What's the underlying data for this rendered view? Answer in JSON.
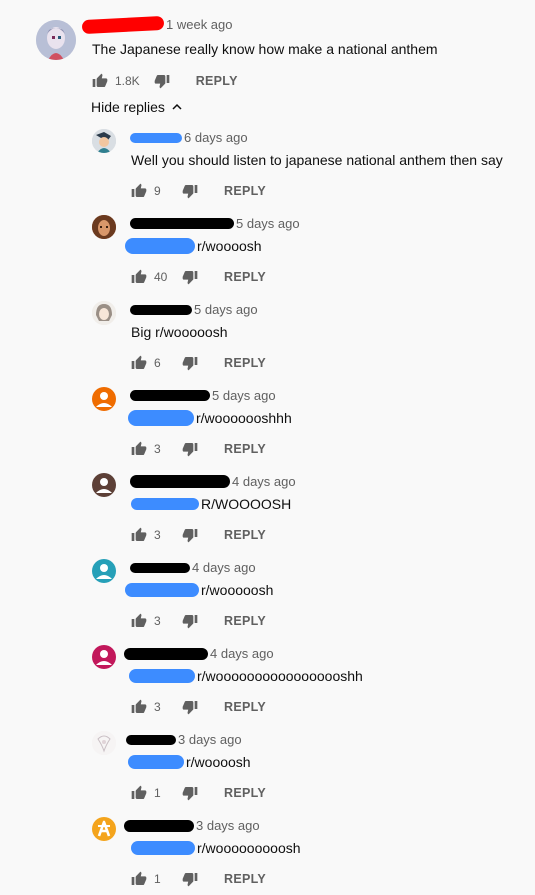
{
  "top_comment": {
    "time": "1 week ago",
    "text": "The Japanese really know how make a national anthem",
    "likes": "1.8K",
    "reply_label": "REPLY"
  },
  "hide_replies_label": "Hide replies",
  "replies": [
    {
      "time": "6 days ago",
      "text": "Well you should listen to japanese national anthem then say",
      "likes": "9",
      "reply_label": "REPLY"
    },
    {
      "time": "5 days ago",
      "text": "r/woooosh",
      "likes": "40",
      "reply_label": "REPLY"
    },
    {
      "time": "5 days ago",
      "text": "Big r/wooooosh",
      "likes": "6",
      "reply_label": "REPLY"
    },
    {
      "time": "5 days ago",
      "text": "r/wooooooshhh",
      "likes": "3",
      "reply_label": "REPLY"
    },
    {
      "time": "4 days ago",
      "text": "R/WOOOOSH",
      "likes": "3",
      "reply_label": "REPLY"
    },
    {
      "time": "4 days ago",
      "text": "r/wooooosh",
      "likes": "3",
      "reply_label": "REPLY"
    },
    {
      "time": "4 days ago",
      "text": "r/wooooooooooooooooshh",
      "likes": "3",
      "reply_label": "REPLY"
    },
    {
      "time": "3 days ago",
      "text": "r/woooosh",
      "likes": "1",
      "reply_label": "REPLY"
    },
    {
      "time": "3 days ago",
      "text": "r/wooooooooosh",
      "likes": "1",
      "reply_label": "REPLY"
    }
  ],
  "colors": {
    "redaction_red": "#ff0000",
    "redaction_black": "#000000",
    "redaction_blue": "#3d8cff",
    "avatar_orange": "#ef6c00",
    "avatar_brown": "#5d4037",
    "avatar_teal": "#26a0b8",
    "avatar_pink": "#c2185b",
    "avatar_gold": "#f4a41c"
  }
}
